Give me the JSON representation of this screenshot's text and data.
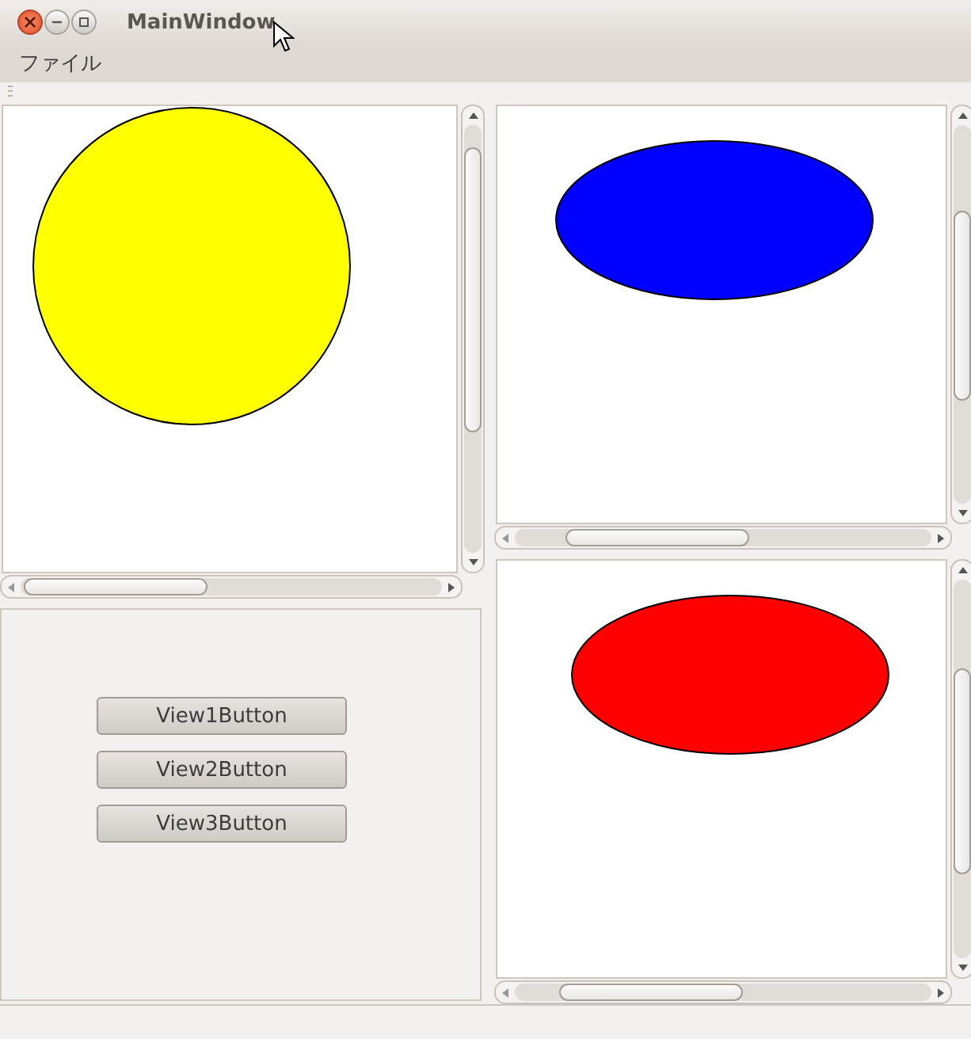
{
  "window": {
    "title": "MainWindow"
  },
  "menu": [
    {
      "label": "ファイル"
    }
  ],
  "views": [
    {
      "kind": "circle",
      "color": "#ffff00"
    },
    {
      "kind": "ellipse",
      "color": "#0000ff"
    },
    {
      "kind": "ellipse",
      "color": "#ff0000"
    }
  ],
  "buttons": [
    "View1Button",
    "View2Button",
    "View3Button"
  ]
}
